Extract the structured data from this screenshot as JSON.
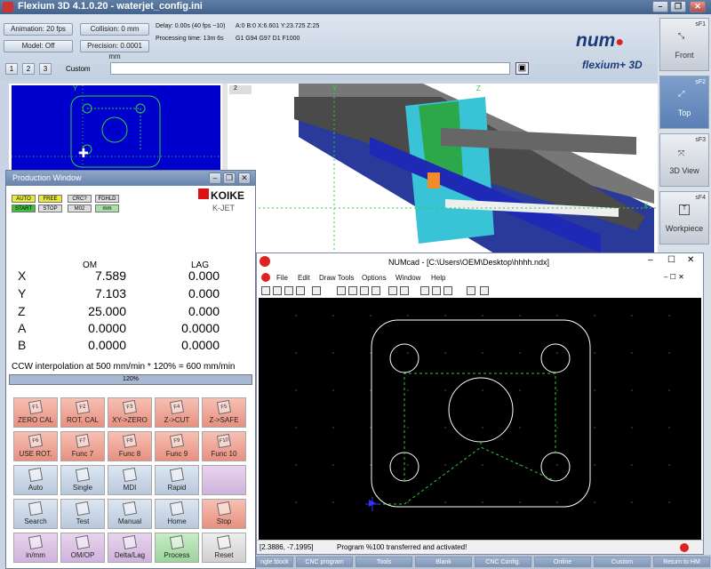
{
  "titlebar": {
    "title": "Flexium 3D 4.1.0.20 - waterjet_config.ini"
  },
  "toolbar": {
    "animation": "Animation: 20 fps",
    "collision": "Collision: 0 mm",
    "model": "Model: Off",
    "precision": "Precision: 0.0001 mm",
    "delay": "Delay: 0.00s (40 fps ~10)",
    "processing": "Processing time: 13m 6s",
    "coords": "A:0  B:0  X:6.601  Y:23.725  Z:25",
    "gcodes": "G1  G94  G97  D1  F1000",
    "tabs": [
      "1",
      "2",
      "3"
    ],
    "custom_label": "Custom",
    "brand_num": "num",
    "brand_flexium": "flexium+ 3D"
  },
  "views": {
    "view1": "1",
    "view2": "2",
    "front": "Front",
    "top": "Top",
    "view3d": "3D View",
    "workpiece": "Workpiece",
    "sf1": "sF1",
    "sf2": "sF2",
    "sf3": "sF3",
    "sf4": "sF4",
    "axis_y": "Y",
    "axis_x": "X",
    "axis_z": "Z"
  },
  "production": {
    "title": "Production Window",
    "status_row1": [
      "AUTO",
      "FREE",
      "CRC?",
      "FDHLD"
    ],
    "status_row2": [
      "START",
      "STOP",
      "M02",
      "mm"
    ],
    "brand": "KOIKE",
    "sub_brand": "K-JET",
    "col_om": "OM",
    "col_lag": "LAG",
    "axes": [
      {
        "name": "X",
        "om": "7.589",
        "lag": "0.000"
      },
      {
        "name": "Y",
        "om": "7.103",
        "lag": "0.000"
      },
      {
        "name": "Z",
        "om": "25.000",
        "lag": "0.000"
      },
      {
        "name": "A",
        "om": "0.0000",
        "lag": "0.0000"
      },
      {
        "name": "B",
        "om": "0.0000",
        "lag": "0.0000"
      }
    ],
    "interp": "CCW interpolation at 500 mm/min * 120% = 600 mm/min",
    "override": "120%",
    "override_fraction": 1.0,
    "fkeys": [
      {
        "num": "F1",
        "label": "ZERO CAL"
      },
      {
        "num": "F2",
        "label": "ROT. CAL"
      },
      {
        "num": "F3",
        "label": "XY->ZERO"
      },
      {
        "num": "F4",
        "label": "Z->CUT"
      },
      {
        "num": "F5",
        "label": "Z->SAFE"
      },
      {
        "num": "F6",
        "label": "USE ROT."
      },
      {
        "num": "F7",
        "label": "Func 7"
      },
      {
        "num": "F8",
        "label": "Func 8"
      },
      {
        "num": "F9",
        "label": "Func 9"
      },
      {
        "num": "F10",
        "label": "Func 10"
      }
    ],
    "modes": [
      "Auto",
      "Single",
      "MDI",
      "Rapid",
      "",
      "Search",
      "Test",
      "Manual",
      "Home",
      "Stop",
      "in/mm",
      "OM/OP",
      "Delta/Lag",
      "Process",
      "Reset"
    ]
  },
  "numcad": {
    "title": "NUMcad - [C:\\Users\\OEM\\Desktop\\hhhh.ndx]",
    "menu": [
      "File",
      "Edit",
      "Draw Tools",
      "Options",
      "Window",
      "Help"
    ],
    "status_coords": "[2.3886, -7.1995]",
    "status_msg": "Program %100 transferred and activated!"
  },
  "bottombar": [
    "ngle block",
    "CNC program",
    "Tools",
    "Blank",
    "CNC Config.",
    "Online",
    "Custom",
    "Return to HM"
  ],
  "colors": {
    "accent": "#5a7fb3",
    "cad_bg": "#000000",
    "path_green": "#2ecc40",
    "view_blue": "#0000cc"
  }
}
